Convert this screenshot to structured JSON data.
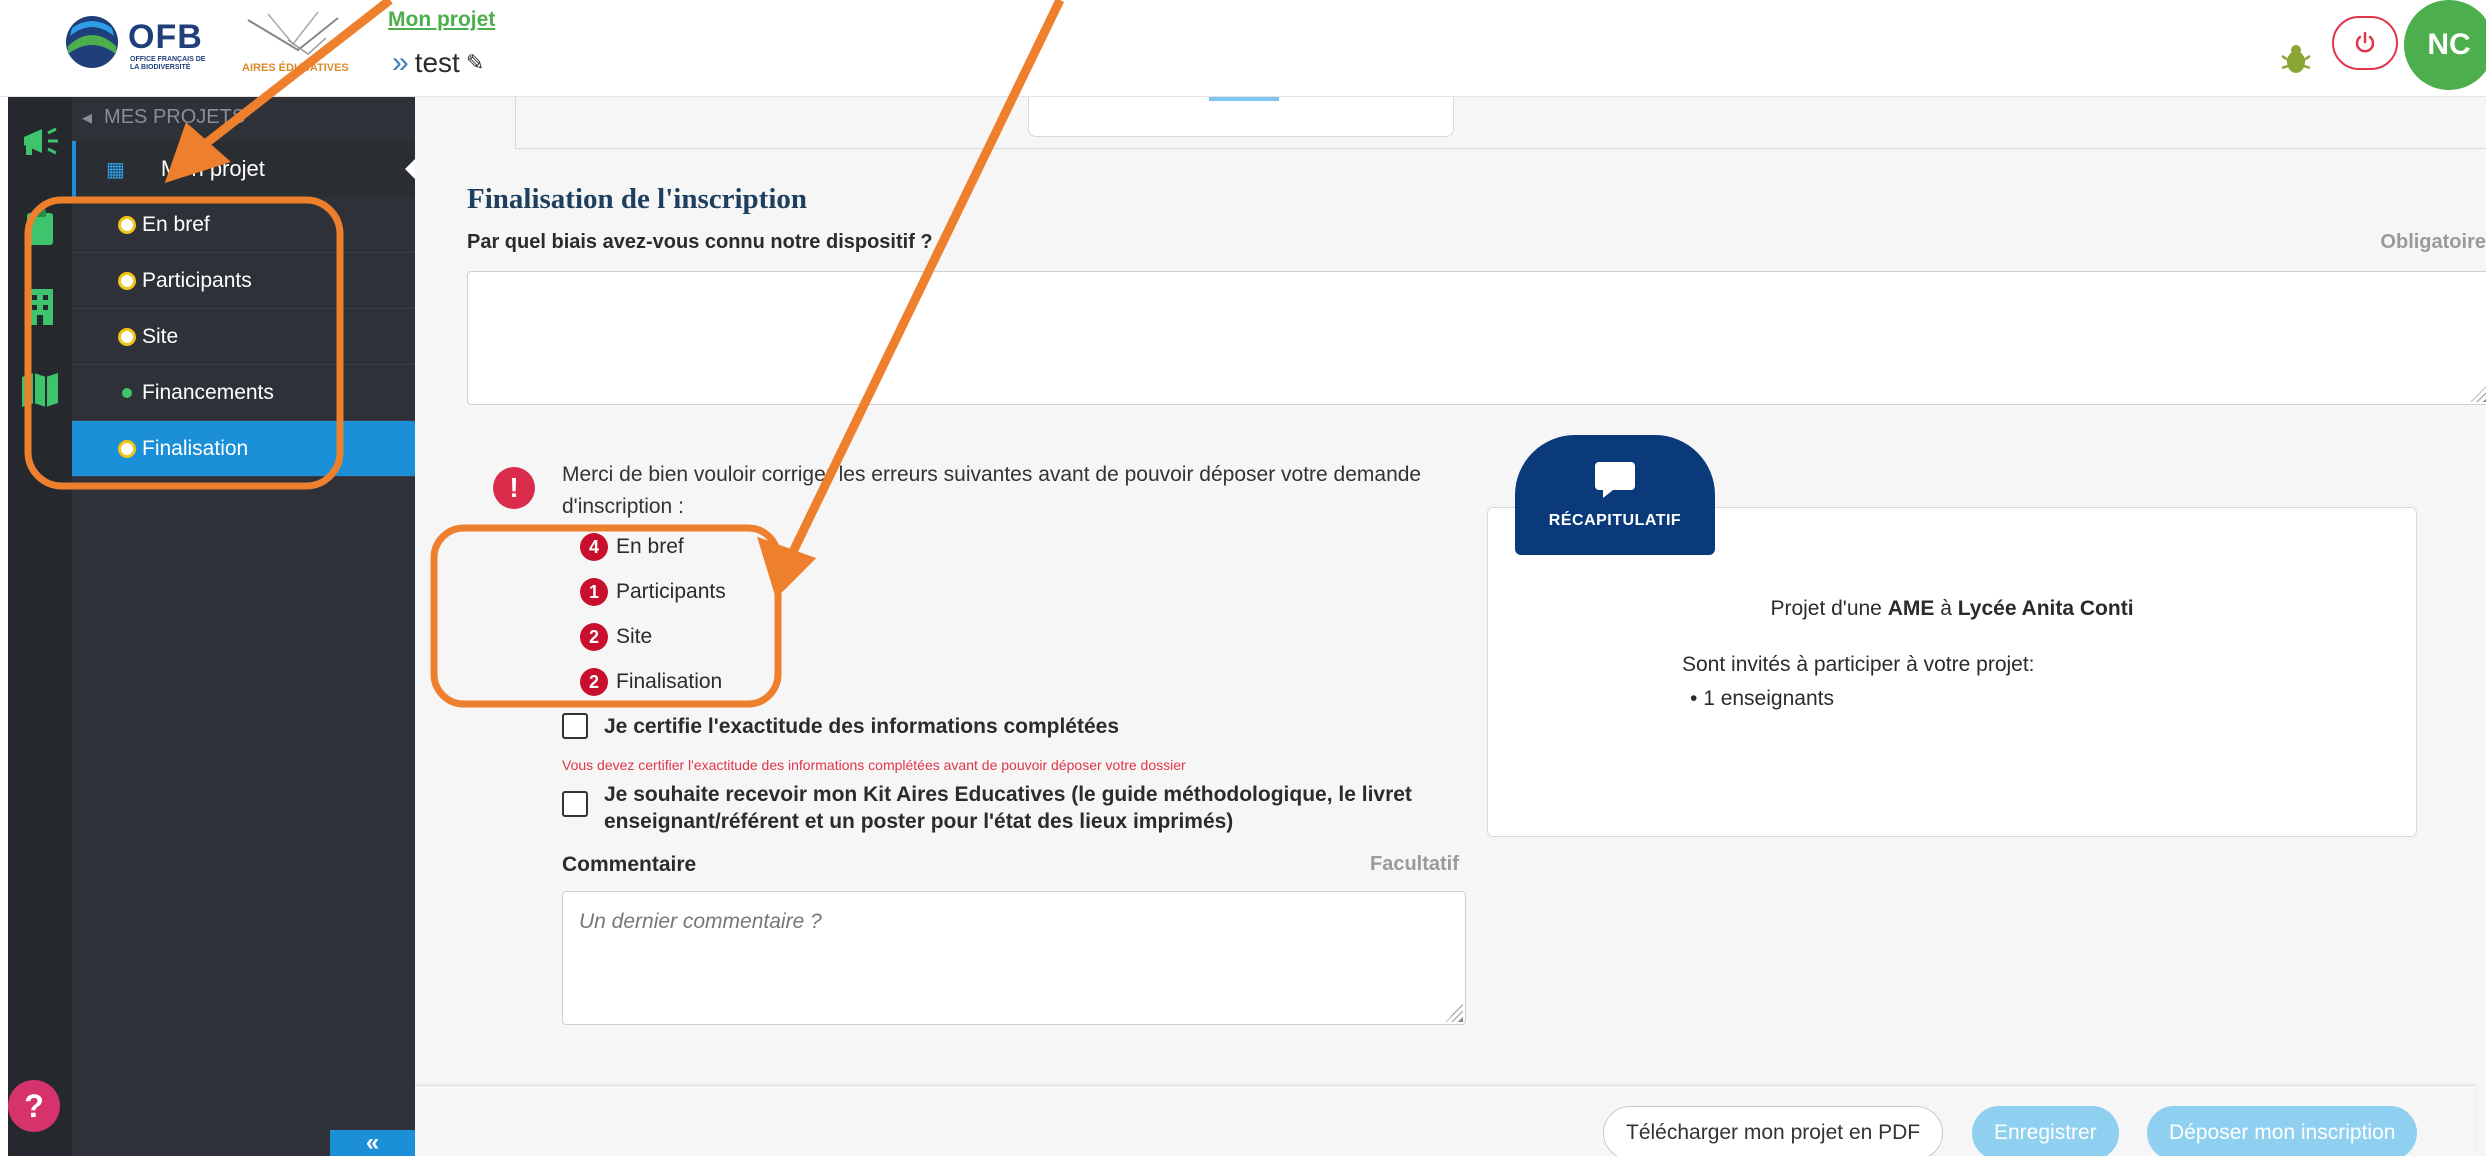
{
  "header": {
    "logo_ofb": "OFB",
    "logo_ofb_sub": "OFFICE FRANÇAIS DE LA BIODIVERSITÉ",
    "logo_aires": "AIRES ÉDUCATIVES",
    "breadcrumb": "Mon projet",
    "project_name": "test",
    "avatar_initials": "NC"
  },
  "sidebar": {
    "section_label": "MES PROJETS",
    "main_item": "Mon projet",
    "items": [
      {
        "label": "En bref",
        "status": "incomplete"
      },
      {
        "label": "Participants",
        "status": "incomplete"
      },
      {
        "label": "Site",
        "status": "incomplete"
      },
      {
        "label": "Financements",
        "status": "complete"
      },
      {
        "label": "Finalisation",
        "status": "incomplete",
        "active": true
      }
    ],
    "collapse_label": "«"
  },
  "main": {
    "section_title": "Finalisation de l'inscription",
    "question_label": "Par quel biais avez-vous connu notre dispositif ?",
    "required_label": "Obligatoire",
    "error_message": "Merci de bien vouloir corriger les erreurs suivantes avant de pouvoir déposer votre demande d'inscription :",
    "errors": [
      {
        "count": "4",
        "label": "En bref"
      },
      {
        "count": "1",
        "label": "Participants"
      },
      {
        "count": "2",
        "label": "Site"
      },
      {
        "count": "2",
        "label": "Finalisation"
      }
    ],
    "certify_label": "Je certifie l'exactitude des informations complétées",
    "certify_warning": "Vous devez certifier l'exactitude des informations complétées avant de pouvoir déposer votre dossier",
    "kit_label": "Je souhaite recevoir mon Kit Aires Educatives (le guide méthodologique, le livret enseignant/référent et un poster pour l'état des lieux imprimés)",
    "comment_label": "Commentaire",
    "comment_optional": "Facultatif",
    "comment_placeholder": "Un dernier commentaire ?"
  },
  "recap": {
    "tab_label": "RÉCAPITULATIF",
    "line1_prefix": "Projet d'une ",
    "line1_type": "AME",
    "line1_mid": " à ",
    "line1_school": "Lycée Anita Conti",
    "invited_label": "Sont invités à participer à votre projet:",
    "invited_items": [
      "1 enseignants"
    ]
  },
  "footer": {
    "pdf_button": "Télécharger mon projet en PDF",
    "save_button": "Enregistrer",
    "submit_button": "Déposer mon inscription"
  },
  "colors": {
    "accent_blue": "#1b8fd8",
    "brand_green": "#4cae4c",
    "error_red": "#c8102e",
    "annotation_orange": "#ee7f2d",
    "recap_navy": "#0a3a7a"
  }
}
